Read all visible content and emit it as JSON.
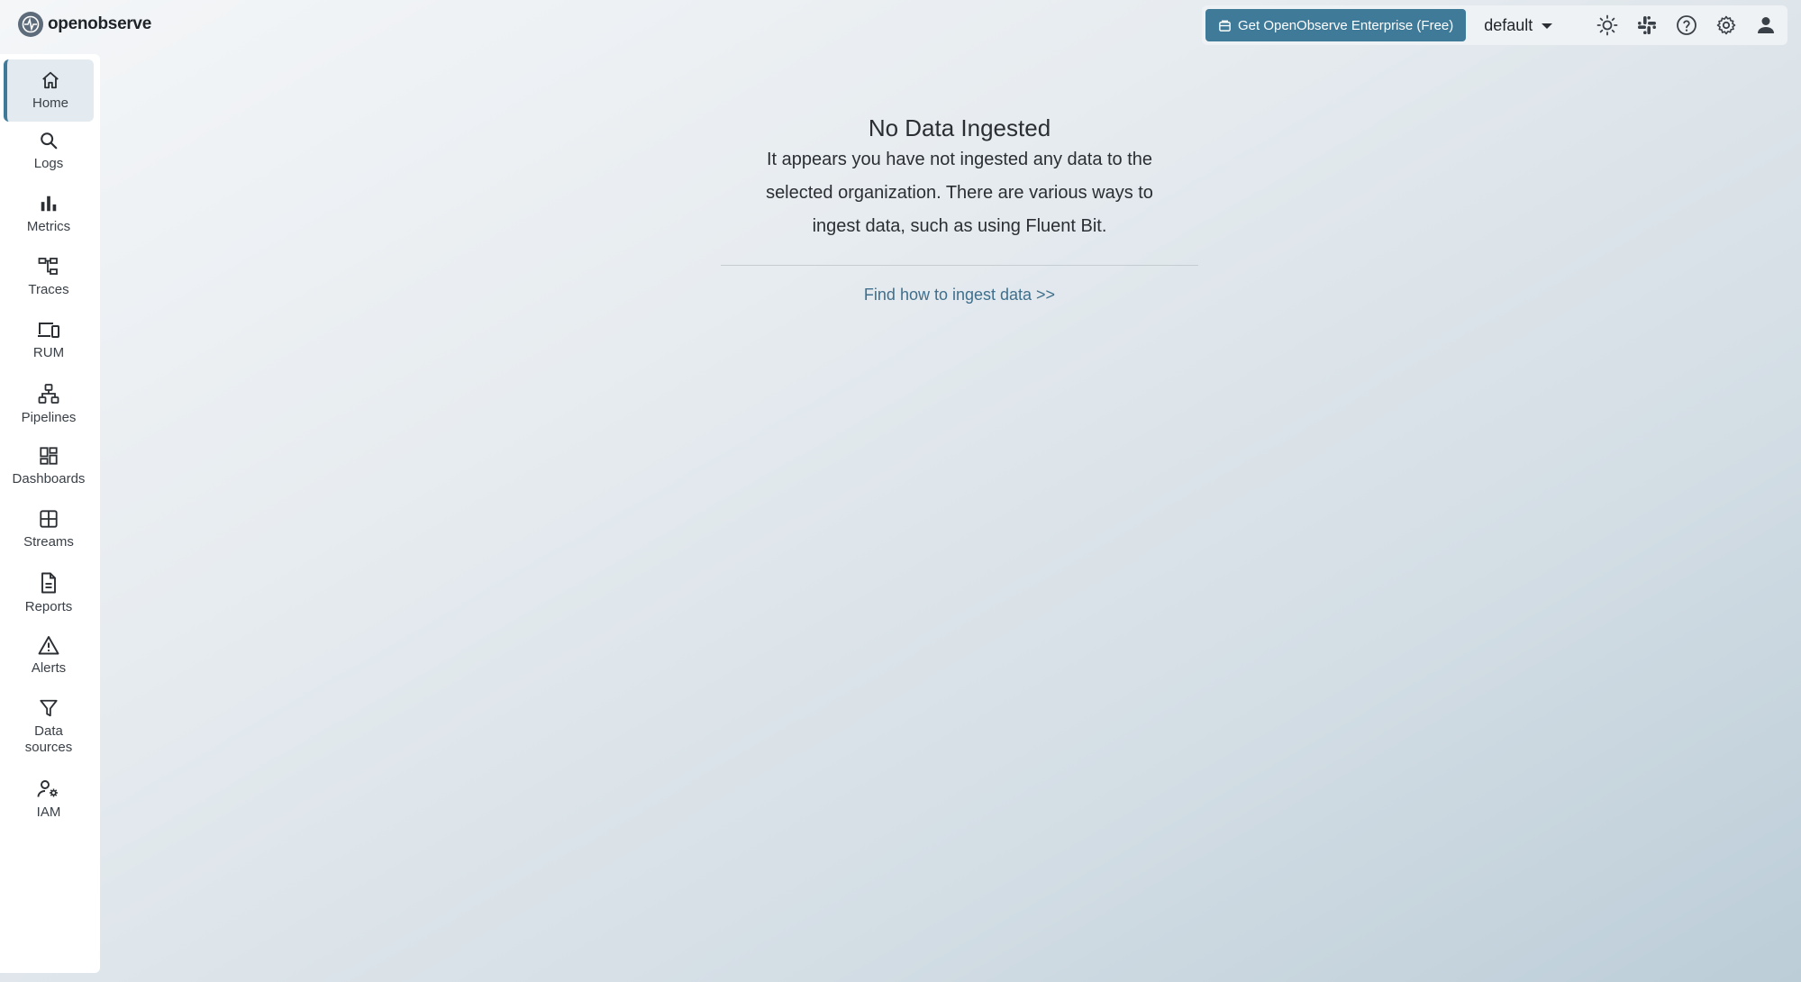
{
  "app": {
    "logo_text": "openobserve"
  },
  "header": {
    "enterprise_button_label": "Get OpenObserve Enterprise (Free)",
    "org_selector_value": "default",
    "icons": [
      "theme-sun-icon",
      "slack-icon",
      "help-icon",
      "settings-gear-icon",
      "user-icon"
    ]
  },
  "sidebar": {
    "items": [
      {
        "label": "Home",
        "icon": "home-icon",
        "active": true
      },
      {
        "label": "Logs",
        "icon": "search-icon"
      },
      {
        "label": "Metrics",
        "icon": "bar-chart-icon"
      },
      {
        "label": "Traces",
        "icon": "traces-icon"
      },
      {
        "label": "RUM",
        "icon": "devices-icon"
      },
      {
        "label": "Pipelines",
        "icon": "pipeline-icon"
      },
      {
        "label": "Dashboards",
        "icon": "dashboard-icon"
      },
      {
        "label": "Streams",
        "icon": "grid-icon"
      },
      {
        "label": "Reports",
        "icon": "document-icon"
      },
      {
        "label": "Alerts",
        "icon": "warning-icon"
      },
      {
        "label": "Data sources",
        "label_line1": "Data",
        "label_line2": "sources",
        "icon": "filter-icon"
      },
      {
        "label": "IAM",
        "icon": "user-settings-icon"
      }
    ]
  },
  "main": {
    "title": "No Data Ingested",
    "description_line1": "It appears you have not ingested any data to the",
    "description_line2": "selected organization. There are various ways to",
    "description_line3": "ingest data, such as using Fluent Bit.",
    "ingest_link": "Find how to ingest data >>"
  },
  "colors": {
    "accent": "#3f7a99",
    "link": "#3f6f8c"
  }
}
